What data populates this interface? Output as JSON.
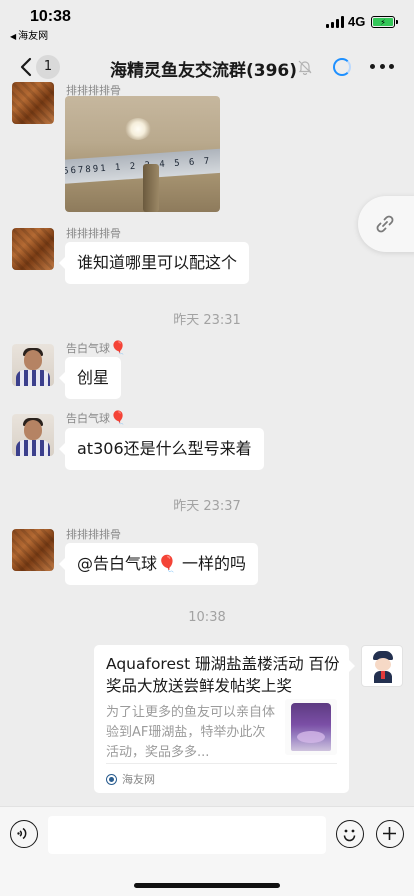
{
  "status_bar": {
    "time": "10:38",
    "back_app": "海友网",
    "network": "4G",
    "battery_charging": "⚡"
  },
  "nav": {
    "unread_count": "1",
    "title": "海精灵鱼友交流群(396)",
    "icons": [
      "back-arrow-icon",
      "mute-bell-icon",
      "loading-icon",
      "more-icon"
    ]
  },
  "messages": [
    {
      "sender": "排排排排骨",
      "type": "image"
    },
    {
      "sender": "排排排排骨",
      "text": "谁知道哪里可以配这个"
    },
    {
      "timestamp": "昨天 23:31"
    },
    {
      "sender": "告白气球",
      "sender_emoji": "🎈",
      "text": "创星"
    },
    {
      "sender": "告白气球",
      "sender_emoji": "🎈",
      "text": "at306还是什么型号来着"
    },
    {
      "timestamp": "昨天 23:37"
    },
    {
      "sender": "排排排排骨",
      "text_prefix": "@告白气球",
      "text_emoji": "🎈",
      "text_suffix": " 一样的吗"
    },
    {
      "timestamp": "10:38"
    },
    {
      "type": "link_card",
      "title": "Aquaforest 珊湖盐盖楼活动 百份奖品大放送尝鲜发帖奖上奖",
      "description": "为了让更多的鱼友可以亲自体验到AF珊湖盐，特举办此次活动，奖品多多...",
      "source": "海友网"
    }
  ],
  "photo": {
    "tape_text": "567891 1 2 3 4 5 6 7"
  },
  "input_bar": {
    "placeholder": ""
  },
  "colors": {
    "background": "#ededed",
    "bubble": "#ffffff",
    "balloon": "#e5323b",
    "battery": "#34c759"
  }
}
